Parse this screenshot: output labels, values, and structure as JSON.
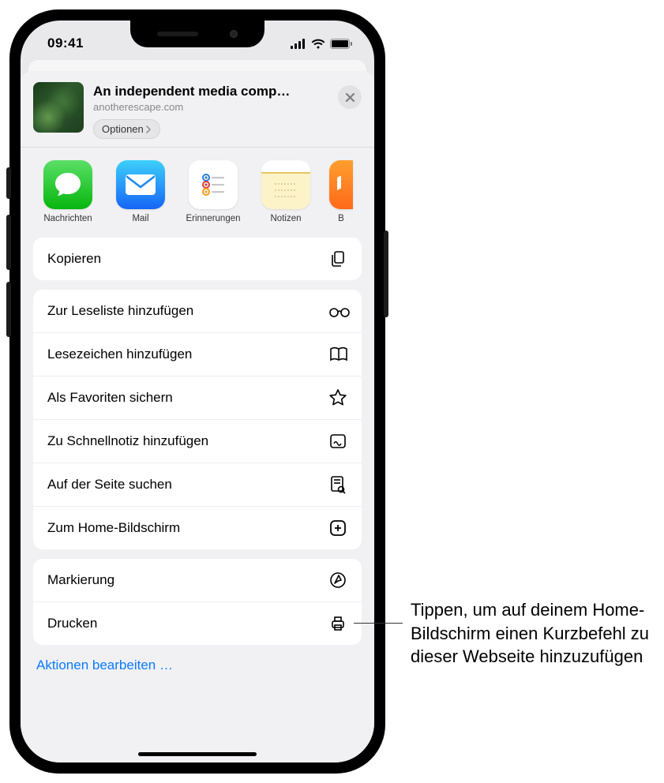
{
  "status": {
    "time": "09:41"
  },
  "share": {
    "title": "An independent media comp…",
    "subtitle": "anotherescape.com",
    "options_label": "Optionen"
  },
  "apps": [
    {
      "id": "messages",
      "label": "Nachrichten"
    },
    {
      "id": "mail",
      "label": "Mail"
    },
    {
      "id": "reminders",
      "label": "Erinnerungen"
    },
    {
      "id": "notes",
      "label": "Notizen"
    },
    {
      "id": "books",
      "label": "B"
    }
  ],
  "actions": {
    "group1": [
      {
        "id": "copy",
        "label": "Kopieren"
      }
    ],
    "group2": [
      {
        "id": "reading-list",
        "label": "Zur Leseliste hinzufügen"
      },
      {
        "id": "bookmark",
        "label": "Lesezeichen hinzufügen"
      },
      {
        "id": "favorite",
        "label": "Als Favoriten sichern"
      },
      {
        "id": "quicknote",
        "label": "Zu Schnellnotiz hinzufügen"
      },
      {
        "id": "find",
        "label": "Auf der Seite suchen"
      },
      {
        "id": "homescreen",
        "label": "Zum Home-Bildschirm"
      }
    ],
    "group3": [
      {
        "id": "markup",
        "label": "Markierung"
      },
      {
        "id": "print",
        "label": "Drucken"
      }
    ],
    "edit": "Aktionen bearbeiten …"
  },
  "callout": "Tippen, um auf deinem Home-Bildschirm einen Kurzbefehl zu dieser Webseite hinzuzufügen"
}
